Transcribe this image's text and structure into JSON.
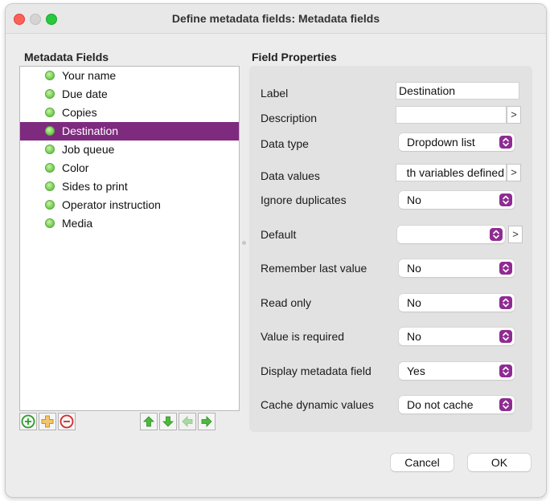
{
  "window": {
    "title": "Define metadata fields: Metadata fields"
  },
  "metadata_fields": {
    "title": "Metadata Fields",
    "items": [
      {
        "label": "Your name"
      },
      {
        "label": "Due date"
      },
      {
        "label": "Copies"
      },
      {
        "label": "Destination",
        "selected": true
      },
      {
        "label": "Job queue"
      },
      {
        "label": "Color"
      },
      {
        "label": "Sides to print"
      },
      {
        "label": "Operator instruction"
      },
      {
        "label": "Media"
      }
    ]
  },
  "field_properties": {
    "title": "Field Properties",
    "label": {
      "label": "Label",
      "value": "Destination"
    },
    "description": {
      "label": "Description",
      "value": "",
      "more": ">"
    },
    "data_type": {
      "label": "Data type",
      "value": "Dropdown list"
    },
    "data_values": {
      "label": "Data values",
      "value": "th variables defined",
      "more": ">"
    },
    "ignore_duplicates": {
      "label": "Ignore duplicates",
      "value": "No"
    },
    "default": {
      "label": "Default",
      "value": "",
      "more": ">"
    },
    "remember_last_value": {
      "label": "Remember last value",
      "value": "No"
    },
    "read_only": {
      "label": "Read only",
      "value": "No"
    },
    "value_is_required": {
      "label": "Value is required",
      "value": "No"
    },
    "display_metadata_field": {
      "label": "Display metadata field",
      "value": "Yes"
    },
    "cache_dynamic_values": {
      "label": "Cache dynamic values",
      "value": "Do not cache"
    }
  },
  "toolbar_icons": [
    "add-circle-icon",
    "duplicate-plus-icon",
    "remove-circle-icon",
    "move-up-arrow-icon",
    "move-down-arrow-icon",
    "move-left-arrow-icon",
    "move-right-arrow-icon"
  ],
  "buttons": {
    "cancel": "Cancel",
    "ok": "OK"
  },
  "colors": {
    "selection": "#7e2a7e",
    "stepper": "#8f2b92",
    "status_dot": "#7fd45a"
  }
}
